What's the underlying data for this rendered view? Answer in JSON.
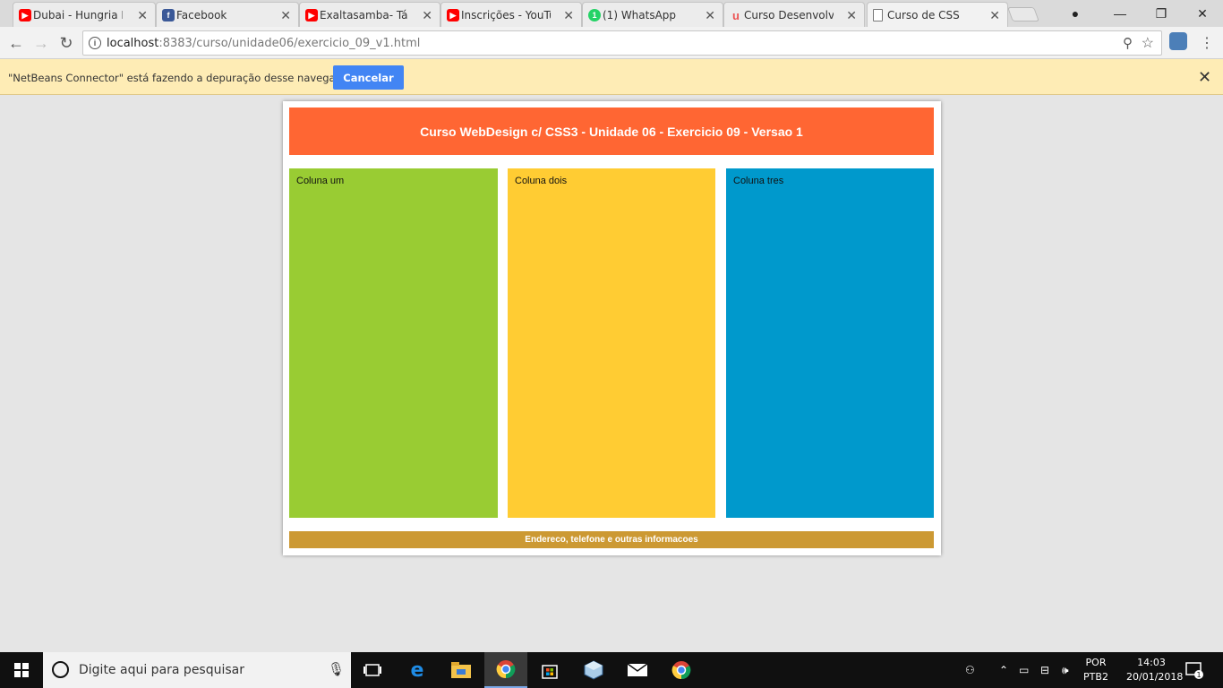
{
  "browser": {
    "tabs": [
      {
        "title": "Dubai - Hungria H",
        "favicon": "youtube-icon",
        "color": "#ff0000"
      },
      {
        "title": "Facebook",
        "favicon": "facebook-icon",
        "color": "#3b5998"
      },
      {
        "title": "Exaltasamba- Tá vc",
        "favicon": "youtube-icon",
        "color": "#ff0000"
      },
      {
        "title": "Inscrições - YouTu",
        "favicon": "youtube-icon",
        "color": "#ff0000"
      },
      {
        "title": "(1) WhatsApp",
        "favicon": "whatsapp-icon",
        "color": "#25d366"
      },
      {
        "title": "Curso Desenvolve",
        "favicon": "udemy-icon",
        "color": "#ec5252"
      },
      {
        "title": "Curso de CSS",
        "favicon": "page-icon",
        "color": "#ffffff"
      }
    ],
    "url_host": "localhost",
    "url_rest": ":8383/curso/unidade06/exercicio_09_v1.html"
  },
  "infobar": {
    "message": "\"NetBeans Connector\" está fazendo a depuração desse navegador.",
    "cancel_label": "Cancelar"
  },
  "page": {
    "header": "Curso WebDesign c/ CSS3 - Unidade 06 - Exercicio 09 - Versao 1",
    "columns": [
      "Coluna um",
      "Coluna dois",
      "Coluna tres"
    ],
    "footer": "Endereco, telefone e outras informacoes",
    "colors": {
      "header": "#ff6633",
      "col1": "#99cc33",
      "col2": "#ffcc33",
      "col3": "#0099cc",
      "footer": "#cc9933"
    }
  },
  "taskbar": {
    "search_placeholder": "Digite aqui para pesquisar",
    "lang_top": "POR",
    "lang_bottom": "PTB2",
    "time": "14:03",
    "date": "20/01/2018",
    "notification_count": "1"
  }
}
